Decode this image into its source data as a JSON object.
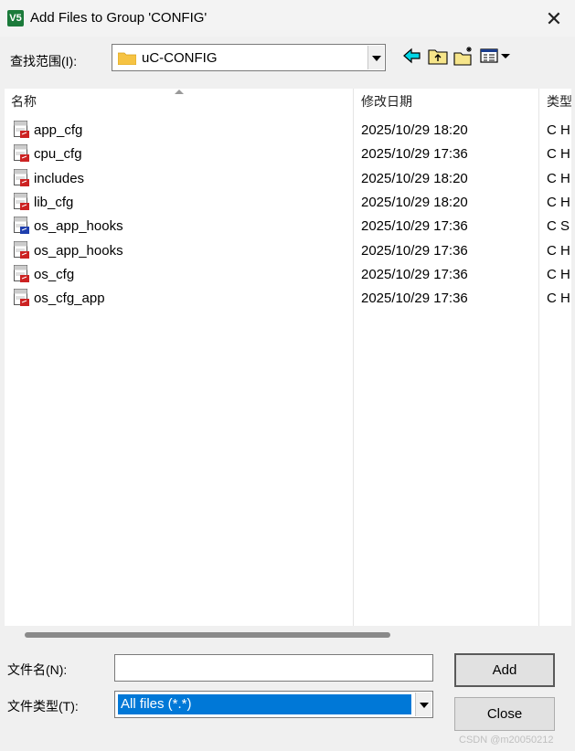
{
  "window": {
    "title": "Add Files to Group 'CONFIG'",
    "app_icon_text": "V5"
  },
  "lookin": {
    "label": "查找范围(I):",
    "value": "uC-CONFIG"
  },
  "toolbar": {
    "icons": [
      "back-icon",
      "up-folder-icon",
      "new-folder-icon",
      "view-menu-icon"
    ]
  },
  "list": {
    "columns": [
      "名称",
      "修改日期",
      "类型"
    ],
    "files": [
      {
        "name": "app_cfg",
        "date": "2025/10/29 18:20",
        "type": "C H",
        "icon": "c-header-file-icon"
      },
      {
        "name": "cpu_cfg",
        "date": "2025/10/29 17:36",
        "type": "C H",
        "icon": "c-header-file-icon"
      },
      {
        "name": "includes",
        "date": "2025/10/29 18:20",
        "type": "C H",
        "icon": "c-header-file-icon"
      },
      {
        "name": "lib_cfg",
        "date": "2025/10/29 18:20",
        "type": "C H",
        "icon": "c-header-file-icon"
      },
      {
        "name": "os_app_hooks",
        "date": "2025/10/29 17:36",
        "type": "C S",
        "icon": "c-source-file-icon"
      },
      {
        "name": "os_app_hooks",
        "date": "2025/10/29 17:36",
        "type": "C H",
        "icon": "c-header-file-icon"
      },
      {
        "name": "os_cfg",
        "date": "2025/10/29 17:36",
        "type": "C H",
        "icon": "c-header-file-icon"
      },
      {
        "name": "os_cfg_app",
        "date": "2025/10/29 17:36",
        "type": "C H",
        "icon": "c-header-file-icon"
      }
    ]
  },
  "filename": {
    "label": "文件名(N):",
    "value": ""
  },
  "filetype": {
    "label": "文件类型(T):",
    "value": "All files (*.*)"
  },
  "buttons": {
    "add": "Add",
    "close": "Close"
  },
  "watermark": "CSDN @m20050212",
  "colors": {
    "selection": "#0078d7",
    "header_icon_red": "#cc2222",
    "source_icon_blue": "#1f3fae",
    "folder": "#f6c343"
  }
}
